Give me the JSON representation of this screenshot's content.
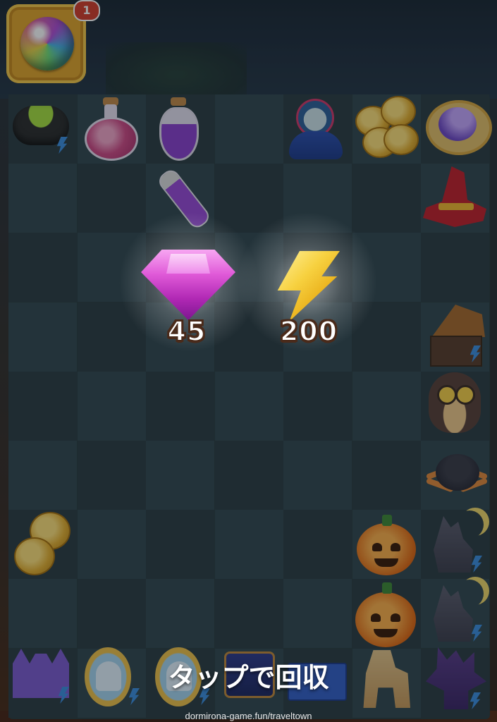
{
  "top_slot": {
    "icon": "rainbow-orb-icon",
    "badge_count": "1"
  },
  "rewards": [
    {
      "icon": "pink-gem-icon",
      "amount": "45"
    },
    {
      "icon": "energy-bolt-icon",
      "amount": "200"
    }
  ],
  "prompt": "タップで回収",
  "watermark": "dormirona-game.fun/traveltown",
  "board": {
    "columns": 7,
    "rows": 9,
    "items": [
      "cauldron-icon",
      "potion-flask-icon",
      "tall-potion-icon",
      "doll-icon",
      "coin-stack-icon",
      "crescent-moon-icon",
      "potion-vial-icon",
      "witch-hat-icon",
      "haunted-house-icon",
      "owl-icon",
      "spider-icon",
      "coin-pair-icon",
      "jack-o-lantern-icon",
      "howling-wolf-icon",
      "carved-pumpkin-icon",
      "howling-wolf-icon",
      "purple-castle-icon",
      "ghost-mirror-icon",
      "ghost-mirror-icon",
      "treasure-chest-icon",
      "blue-blocks-icon",
      "knight-horse-icon",
      "twisted-tree-icon"
    ]
  },
  "colors": {
    "gem": "#e05ad8",
    "bolt": "#f7d140",
    "badge": "#d63c2a",
    "slot": "#e3a52a"
  }
}
